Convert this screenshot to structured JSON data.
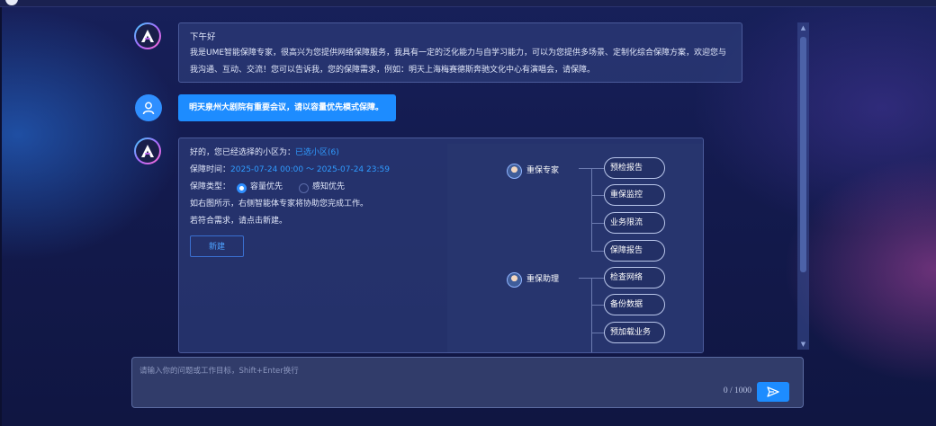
{
  "chat": {
    "ai_greeting": {
      "hello": "下午好",
      "line1": "我是UME智能保障专家，很高兴为您提供网络保障服务，我具有一定的泛化能力与自学习能力，可以为您提供多场景、定制化综合保障方案，欢迎您与",
      "line2": "我沟通、互动、交流！您可以告诉我，您的保障需求，例如：明天上海梅赛德斯奔驰文化中心有演唱会，请保障。"
    },
    "user_message": "明天泉州大剧院有重要会议，请以容量优先模式保障。",
    "ai_reply": {
      "area_prefix": "好的，您已经选择的小区为：",
      "area_link": "已选小区(6)",
      "time_prefix": "保障时间：",
      "time_value": "2025-07-24 00:00 ～ 2025-07-24 23:59",
      "type_label": "保障类型：",
      "type_options": [
        "容量优先",
        "感知优先"
      ],
      "type_selected": "容量优先",
      "line_agents": "如右图所示，右侧智能体专家将协助您完成工作。",
      "line_confirm": "若符合需求，请点击新建。",
      "new_button": "新建"
    }
  },
  "agent_tree": {
    "experts": [
      {
        "name": "重保专家",
        "tasks": [
          "预检报告",
          "重保监控",
          "业务限流",
          "保障报告"
        ]
      },
      {
        "name": "重保助理",
        "tasks": [
          "检查网络",
          "备份数据",
          "预加载业务"
        ]
      }
    ]
  },
  "composer": {
    "placeholder": "请输入你的问题或工作目标，Shift+Enter换行",
    "counter": "0 / 1000"
  },
  "icons": {
    "ai_avatar": "ume-logo-icon",
    "user_avatar": "user-icon",
    "send": "send-icon"
  },
  "colors": {
    "accent": "#1d8cff",
    "link": "#2f9bff",
    "background": "#131a4d"
  }
}
